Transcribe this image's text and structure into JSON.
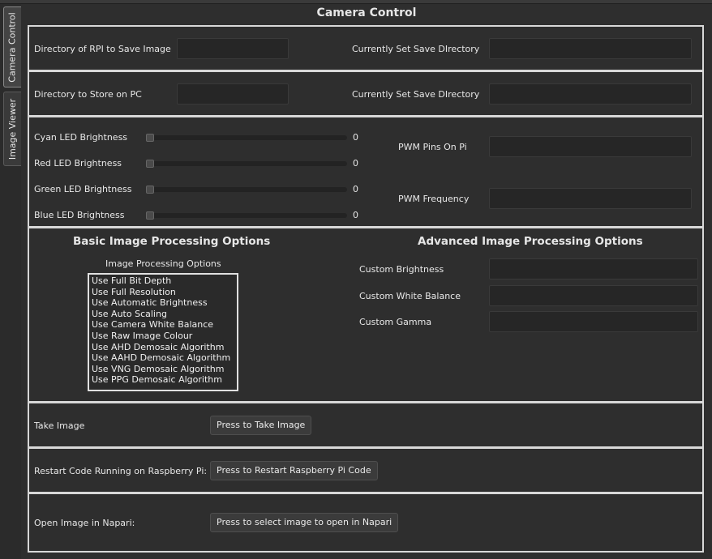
{
  "window": {
    "title": "Camera Control"
  },
  "tabs": {
    "camera_control": "Camera Control",
    "image_viewer": "Image Viewer"
  },
  "rpi_dir": {
    "label": "Directory of RPI to Save Image",
    "value": "",
    "current_label": "Currently Set Save DIrectory",
    "current_value": ""
  },
  "pc_dir": {
    "label": "Directory to Store on PC",
    "value": "",
    "current_label": "Currently Set Save DIrectory",
    "current_value": ""
  },
  "leds": {
    "cyan": {
      "label": "Cyan LED Brightness",
      "value": "0",
      "level": 0
    },
    "red": {
      "label": "Red LED Brightness",
      "value": "0",
      "level": 0
    },
    "green": {
      "label": "Green LED Brightness",
      "value": "0",
      "level": 0
    },
    "blue": {
      "label": "Blue LED Brightness",
      "value": "0",
      "level": 0
    },
    "pwm_pins_label": "PWM Pins On Pi",
    "pwm_pins_value": "",
    "pwm_freq_label": "PWM Frequency",
    "pwm_freq_value": ""
  },
  "basic": {
    "header": "Basic Image Processing Options",
    "list_title": "Image Processing Options",
    "options": [
      "Use Full Bit Depth",
      "Use Full Resolution",
      "Use Automatic Brightness",
      "Use Auto Scaling",
      "Use Camera White Balance",
      "Use Raw Image Colour",
      "Use AHD Demosaic Algorithm",
      "Use AAHD Demosaic Algorithm",
      "Use VNG Demosaic Algorithm",
      "Use PPG Demosaic Algorithm"
    ]
  },
  "advanced": {
    "header": "Advanced Image Processing Options",
    "brightness_label": "Custom Brightness",
    "brightness_value": "",
    "wb_label": "Custom White Balance",
    "wb_value": "",
    "gamma_label": "Custom Gamma",
    "gamma_value": ""
  },
  "take": {
    "label": "Take Image",
    "button": "Press to Take Image"
  },
  "restart": {
    "label": "Restart Code Running on Raspberry Pi:",
    "button": "Press to Restart Raspberry Pi Code"
  },
  "napari": {
    "label": "Open Image in Napari:",
    "button": "Press to select image to open in Napari"
  },
  "colors": {
    "background": "#2e2e2e",
    "border": "#d8d8d8",
    "field": "#262626"
  }
}
